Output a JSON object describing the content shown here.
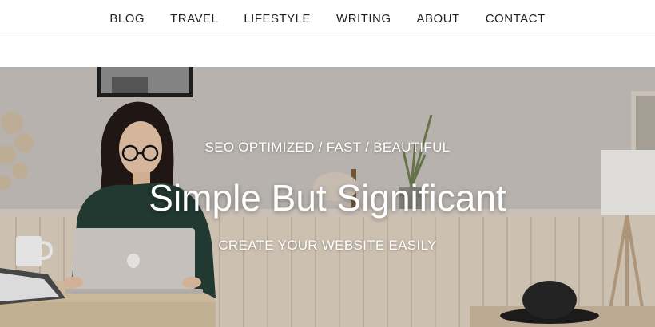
{
  "nav": {
    "items": [
      {
        "label": "BLOG"
      },
      {
        "label": "TRAVEL"
      },
      {
        "label": "LIFESTYLE"
      },
      {
        "label": "WRITING"
      },
      {
        "label": "ABOUT"
      },
      {
        "label": "CONTACT"
      }
    ]
  },
  "hero": {
    "tagline": "SEO OPTIMIZED / FAST / BEAUTIFUL",
    "title": "Simple But Significant",
    "subtitle": "CREATE YOUR WEBSITE EASILY",
    "text_color": "#ffffff",
    "background_photo": "woman-with-laptop-photo"
  },
  "colors": {
    "nav_text": "#222222",
    "nav_border": "#555555",
    "page_background": "#ffffff"
  }
}
